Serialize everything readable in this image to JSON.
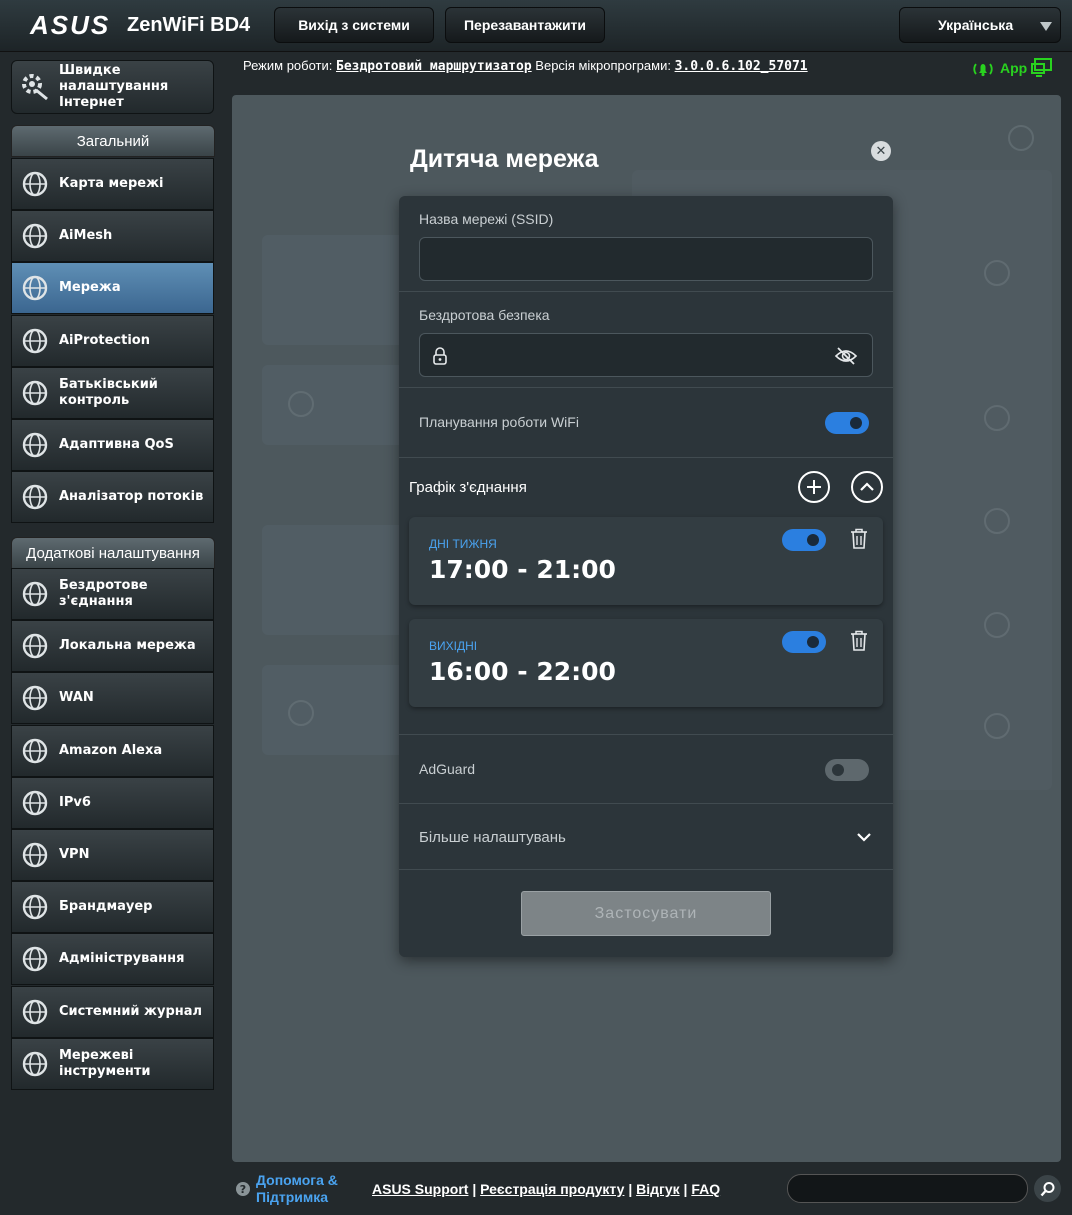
{
  "header": {
    "brand": "ASUS",
    "model": "ZenWiFi BD4",
    "logout_label": "Вихід з системи",
    "reboot_label": "Перезавантажити",
    "language": "Українська"
  },
  "info": {
    "mode_label": "Режим роботи:",
    "mode_value": "Бездротовий маршрутизатор",
    "fw_label": "Версія мікропрограми:",
    "fw_value": "3.0.0.6.102_57071",
    "app_label": "App"
  },
  "sidebar": {
    "quick": "Швидке налаштування Інтернет",
    "general_header": "Загальний",
    "general": [
      {
        "label": "Карта мережі",
        "icon": "globe-map-icon"
      },
      {
        "label": "AiMesh",
        "icon": "aimesh-icon"
      },
      {
        "label": "Мережа",
        "icon": "network-globe-icon"
      },
      {
        "label": "AiProtection",
        "icon": "shield-lock-icon"
      },
      {
        "label": "Батьківський контроль",
        "icon": "family-icon"
      },
      {
        "label": "Адаптивна QoS",
        "icon": "gauge-icon"
      },
      {
        "label": "Аналізатор потоків",
        "icon": "waveform-icon"
      }
    ],
    "advanced_header": "Додаткові налаштування",
    "advanced": [
      {
        "label": "Бездротове з'єднання",
        "icon": "wireless-icon"
      },
      {
        "label": "Локальна мережа",
        "icon": "lan-icon"
      },
      {
        "label": "WAN",
        "icon": "wan-globe-icon"
      },
      {
        "label": "Amazon Alexa",
        "icon": "alexa-icon"
      },
      {
        "label": "IPv6",
        "icon": "ipv6-icon"
      },
      {
        "label": "VPN",
        "icon": "vpn-icon"
      },
      {
        "label": "Брандмауер",
        "icon": "firewall-icon"
      },
      {
        "label": "Адміністрування",
        "icon": "admin-gear-icon"
      },
      {
        "label": "Системний журнал",
        "icon": "log-icon"
      },
      {
        "label": "Мережеві інструменти",
        "icon": "tools-gear-icon"
      }
    ]
  },
  "modal": {
    "title": "Дитяча мережа",
    "ssid_label": "Назва мережі (SSID)",
    "ssid_value": "",
    "security_label": "Бездротова безпека",
    "security_value": "",
    "wifi_schedule_label": "Планування роботи WiFi",
    "wifi_schedule_on": true,
    "schedule_title": "Графік з'єднання",
    "schedules": [
      {
        "day": "ДНІ ТИЖНЯ",
        "time": "17:00 - 21:00",
        "enabled": true
      },
      {
        "day": "ВИХІДНІ",
        "time": "16:00 - 22:00",
        "enabled": true
      }
    ],
    "adguard_label": "AdGuard",
    "adguard_on": false,
    "more_label": "Більше налаштувань",
    "apply_label": "Застосувати"
  },
  "footer": {
    "help_line1": "Допомога &",
    "help_line2": "Підтримка",
    "link_support": "ASUS Support",
    "link_register": "Реєстрація продукту",
    "link_feedback": "Відгук",
    "link_faq": "FAQ",
    "search_value": ""
  },
  "colors": {
    "accent_blue": "#2b7fe0",
    "app_green": "#29d21f",
    "link_blue": "#4aa3f0"
  }
}
